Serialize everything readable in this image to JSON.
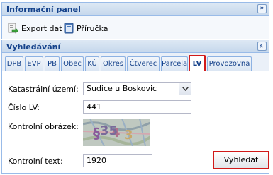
{
  "info_panel": {
    "title": "Informační panel",
    "collapse_glyph": "»"
  },
  "toolbar": {
    "export_label": "Export dat",
    "manual_label": "Příručka"
  },
  "search_panel": {
    "title": "Vyhledávání",
    "collapse_glyph": "»"
  },
  "tabs": [
    {
      "label": "DPB"
    },
    {
      "label": "EVP"
    },
    {
      "label": "PB"
    },
    {
      "label": "Obec"
    },
    {
      "label": "KÚ"
    },
    {
      "label": "Okres"
    },
    {
      "label": "Čtverec"
    },
    {
      "label": "Parcela"
    },
    {
      "label": "LV"
    },
    {
      "label": "Provozovna"
    }
  ],
  "active_tab": "LV",
  "form": {
    "cadastral_label": "Katastrální území:",
    "cadastral_value": "Sudice u Boskovic",
    "lv_label": "Číslo LV:",
    "lv_value": "441",
    "captcha_label": "Kontrolní obrázek:",
    "captcha_text": "35",
    "control_label": "Kontrolní text:",
    "control_value": "1920",
    "search_button": "Vyhledat"
  },
  "colors": {
    "header_text": "#15428b",
    "highlight": "#d11a1a",
    "border": "#99bbe8"
  }
}
